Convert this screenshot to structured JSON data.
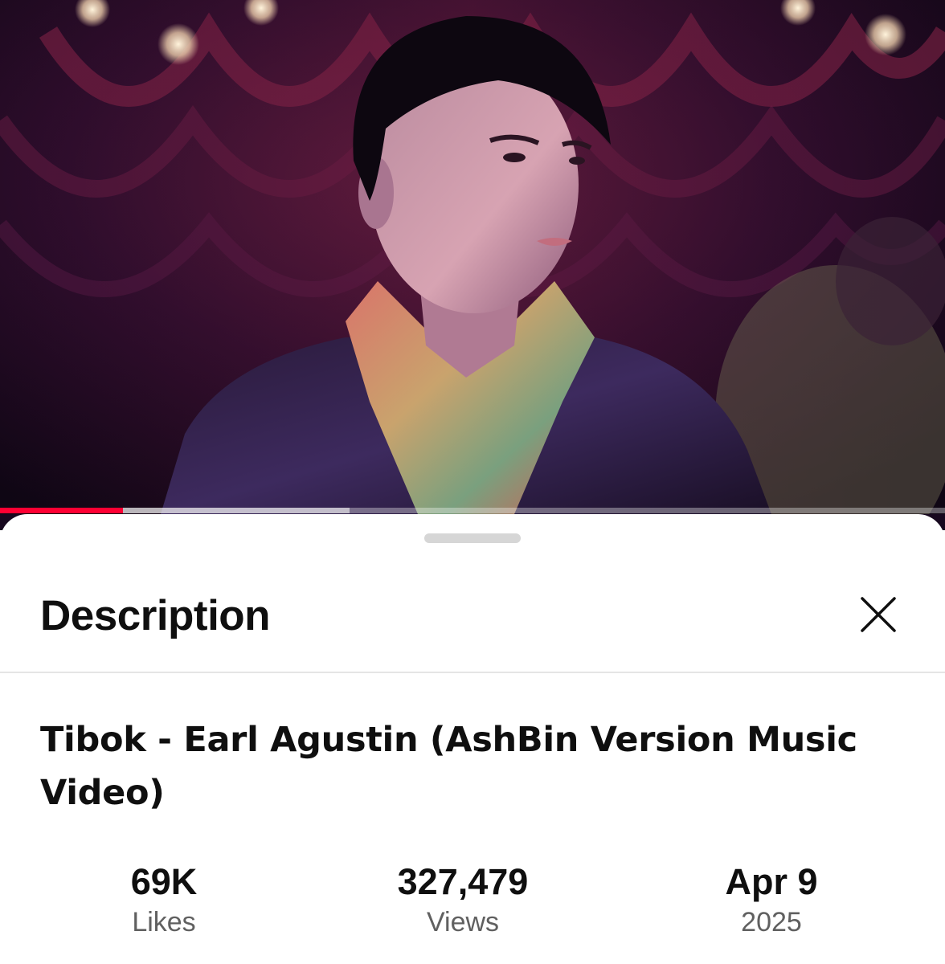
{
  "video": {
    "played_fraction": 0.13,
    "buffered_fraction": 0.37,
    "progress_color": "#ff0033"
  },
  "sheet": {
    "title": "Description",
    "close_icon": "close-icon"
  },
  "details": {
    "title": "Tibok - Earl Agustin (AshBin Version Music Video)"
  },
  "stats": [
    {
      "value": "69K",
      "label": "Likes"
    },
    {
      "value": "327,479",
      "label": "Views"
    },
    {
      "value": "Apr 9",
      "label": "2025"
    }
  ]
}
